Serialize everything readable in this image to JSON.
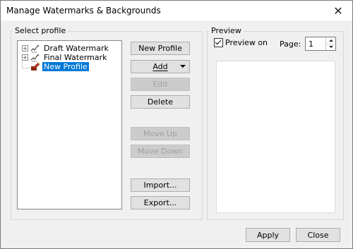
{
  "window": {
    "title": "Manage Watermarks & Backgrounds",
    "close_glyph": "✕"
  },
  "profile_group": {
    "label": "Select profile",
    "tree": [
      {
        "label": "Draft Watermark",
        "expander": "+",
        "icon": "watermark-icon"
      },
      {
        "label": "Final Watermark",
        "expander": "+",
        "icon": "watermark-icon"
      },
      {
        "label": "New Profile",
        "icon": "new-profile-icon",
        "selected": true
      }
    ]
  },
  "buttons": {
    "new_profile": "New Profile",
    "add": "Add",
    "edit": "Edit",
    "delete": "Delete",
    "move_up": "Move Up",
    "move_down": "Move Down",
    "import": "Import...",
    "export": "Export...",
    "apply": "Apply",
    "close": "Close"
  },
  "preview_group": {
    "label": "Preview",
    "preview_on_label": "Preview on",
    "preview_on_checked": true,
    "page_label": "Page:",
    "page_value": "1"
  },
  "colors": {
    "selection": "#0078d7",
    "window_bg": "#f0f0f0"
  }
}
